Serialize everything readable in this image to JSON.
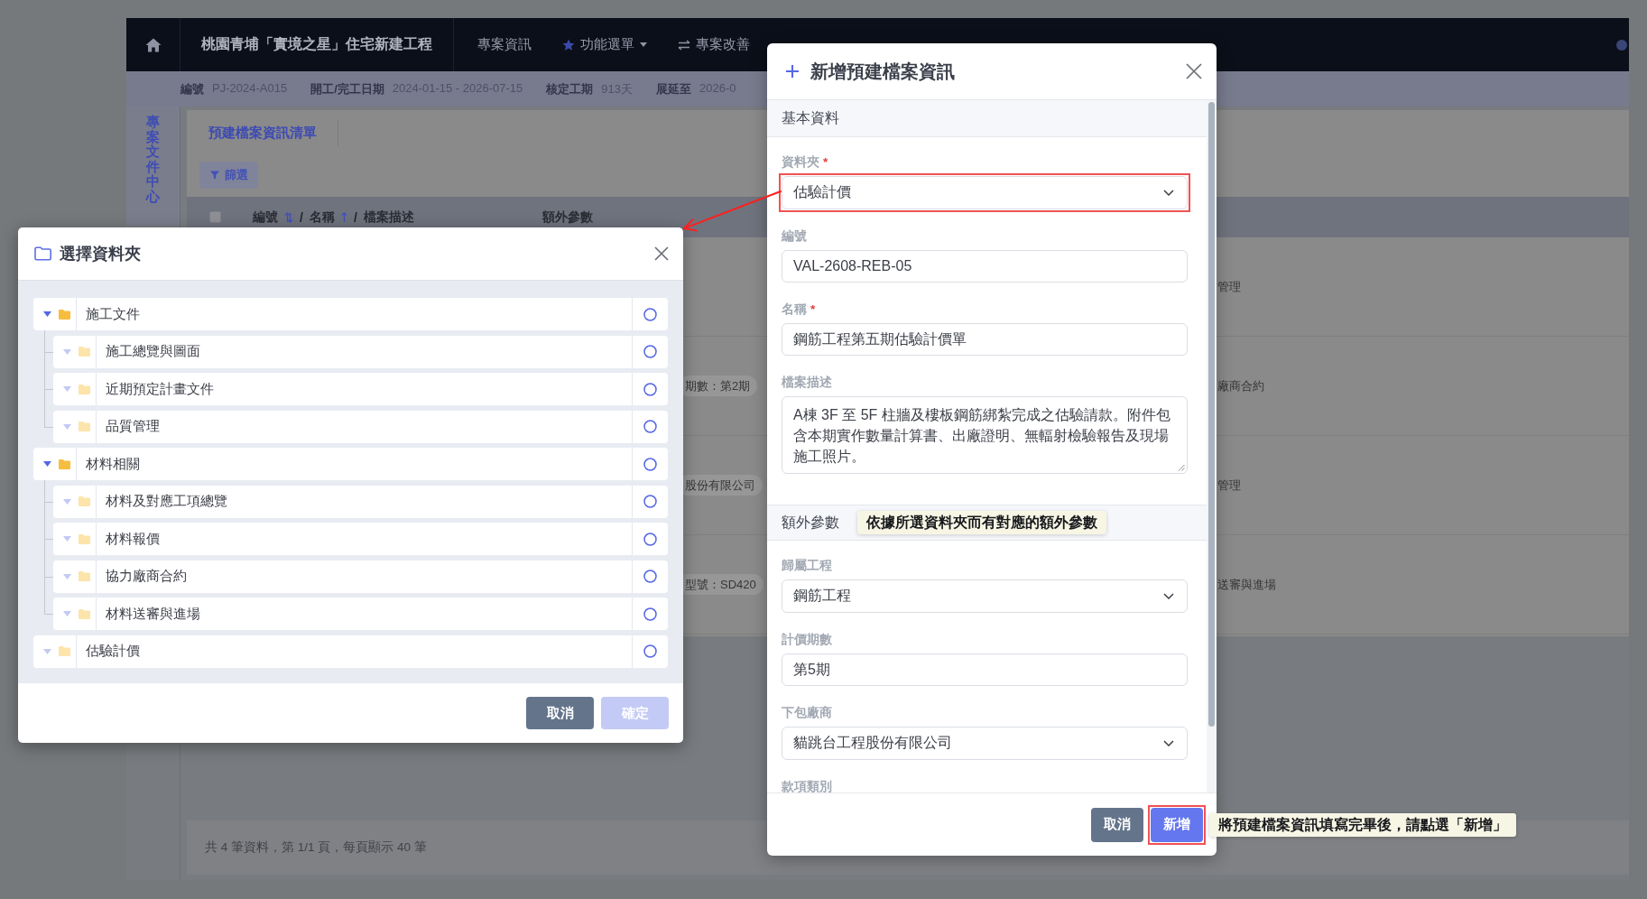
{
  "app": {
    "top_bar": {
      "project_title": "桃園青埔「實境之星」住宅新建工程",
      "nav": [
        {
          "label": "專案資訊",
          "kind": "link"
        },
        {
          "label": "功能選單",
          "kind": "dropdown"
        },
        {
          "label": "專案改善",
          "kind": "action"
        }
      ]
    },
    "info_bar": [
      {
        "label": "編號",
        "value": "PJ-2024-A015"
      },
      {
        "label": "開工/完工日期",
        "value": "2024-01-15 - 2026-07-15"
      },
      {
        "label": "核定工期",
        "value": "913天"
      },
      {
        "label": "展延至",
        "value": "2026-0"
      }
    ],
    "sidebar": {
      "tab_label": "專案文件中心"
    },
    "list": {
      "title": "預建檔案資訊清單",
      "filter_button": "篩選",
      "header": {
        "checked": false,
        "column_1": [
          {
            "kind": "label",
            "text": "編號",
            "arrow_up": true,
            "arrow_down": true
          },
          {
            "kind": "separator",
            "text": "/"
          },
          {
            "kind": "label",
            "text": "名稱",
            "arrow_up": true,
            "arrow_down": false
          },
          {
            "kind": "separator",
            "text": "/"
          },
          {
            "kind": "label",
            "text": "檔案描述",
            "arrow_up": false,
            "arrow_down": false
          }
        ],
        "column_2": "額外參數"
      },
      "rows": [
        {
          "column_3": "管理"
        },
        {
          "column_2": "期數：第2期",
          "column_3": "廠商合約"
        },
        {
          "column_2": "股份有限公司",
          "column_3": "管理"
        },
        {
          "column_2": "型號：SD420",
          "column_3": "送審與進場"
        }
      ],
      "summary": "共 4 筆資料，第 1/1 頁，每頁顯示 40 筆"
    }
  },
  "folder_dialog": {
    "title": "選擇資料夾",
    "tree": [
      {
        "label": "施工文件",
        "expanded": true,
        "selected": false,
        "children": [
          {
            "label": "施工總覽與圖面",
            "expanded": false,
            "selected": false
          },
          {
            "label": "近期預定計畫文件",
            "expanded": false,
            "selected": false
          },
          {
            "label": "品質管理",
            "expanded": false,
            "selected": false
          }
        ]
      },
      {
        "label": "材料相關",
        "expanded": true,
        "selected": false,
        "children": [
          {
            "label": "材料及對應工項總覽",
            "expanded": false,
            "selected": false
          },
          {
            "label": "材料報價",
            "expanded": false,
            "selected": false
          },
          {
            "label": "協力廠商合約",
            "expanded": false,
            "selected": false
          },
          {
            "label": "材料送審與進場",
            "expanded": false,
            "selected": false
          }
        ]
      },
      {
        "label": "估驗計價",
        "expanded": false,
        "selected": false
      }
    ],
    "buttons": [
      {
        "label": "取消",
        "kind": "cancel",
        "disabled": false
      },
      {
        "label": "確定",
        "kind": "confirm",
        "disabled": true
      }
    ]
  },
  "form_dialog": {
    "title": "新增預建檔案資訊",
    "required_mark": "*",
    "sections": [
      {
        "title": "基本資料",
        "fields": [
          {
            "label": "資料夾",
            "required": true,
            "kind": "select",
            "value": "估驗計價",
            "highlighted": true
          },
          {
            "label": "編號",
            "required": false,
            "kind": "text",
            "value": "VAL-2608-REB-05",
            "highlighted": false
          },
          {
            "label": "名稱",
            "required": true,
            "kind": "text",
            "value": "鋼筋工程第五期估驗計價單",
            "highlighted": false
          },
          {
            "label": "檔案描述",
            "required": false,
            "kind": "textarea",
            "value": "A棟 3F 至 5F 柱牆及樓板鋼筋綁紮完成之估驗請款。附件包含本期實作數量計算書、出廠證明、無輻射檢驗報告及現場施工照片。",
            "highlighted": false
          }
        ]
      },
      {
        "title": "額外參數",
        "note": "依據所選資料夾而有對應的額外參數",
        "fields": [
          {
            "label": "歸屬工程",
            "required": false,
            "kind": "select",
            "value": "鋼筋工程",
            "highlighted": false
          },
          {
            "label": "計價期數",
            "required": false,
            "kind": "text",
            "value": "第5期",
            "highlighted": false
          },
          {
            "label": "下包廠商",
            "required": false,
            "kind": "select",
            "value": "貓跳台工程股份有限公司",
            "highlighted": false
          },
          {
            "label": "款項類別",
            "required": false,
            "kind": "label_only",
            "highlighted": false
          }
        ]
      }
    ],
    "buttons": [
      {
        "label": "取消",
        "kind": "cancel",
        "highlighted": false
      },
      {
        "label": "新增",
        "kind": "submit",
        "highlighted": true,
        "callout": "將預建檔案資訊填寫完畢後，請點選「新增」"
      }
    ]
  }
}
